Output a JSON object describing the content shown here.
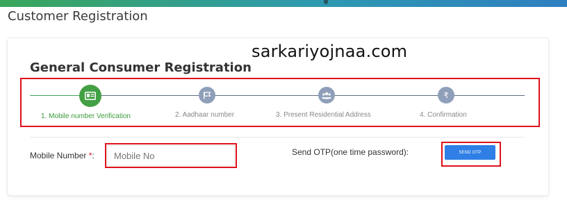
{
  "page": {
    "title": "Customer Registration"
  },
  "watermark": "sarkariyojnaa.com",
  "card": {
    "title": "General Consumer Registration"
  },
  "steps": [
    {
      "label": "1. Mobile number Verification",
      "icon": "id-card-icon",
      "active": true
    },
    {
      "label": "2. Aadhaar number",
      "icon": "flag-icon",
      "active": false
    },
    {
      "label": "3. Present Residential Address",
      "icon": "users-icon",
      "active": false
    },
    {
      "label": "4. Confirmation",
      "icon": "rupee-icon",
      "glyph": "₹",
      "active": false
    }
  ],
  "form": {
    "mobile_label": "Mobile Number",
    "required_marker": "*",
    "label_suffix": ":",
    "mobile_placeholder": "Mobile No",
    "mobile_value": "",
    "otp_label": "Send OTP(one time password):",
    "otp_button": "SEND OTP"
  },
  "colors": {
    "active_step": "#44a044",
    "inactive_step": "#8f9fb9",
    "button": "#2f7fe6",
    "highlight_box": "#e0101b"
  }
}
